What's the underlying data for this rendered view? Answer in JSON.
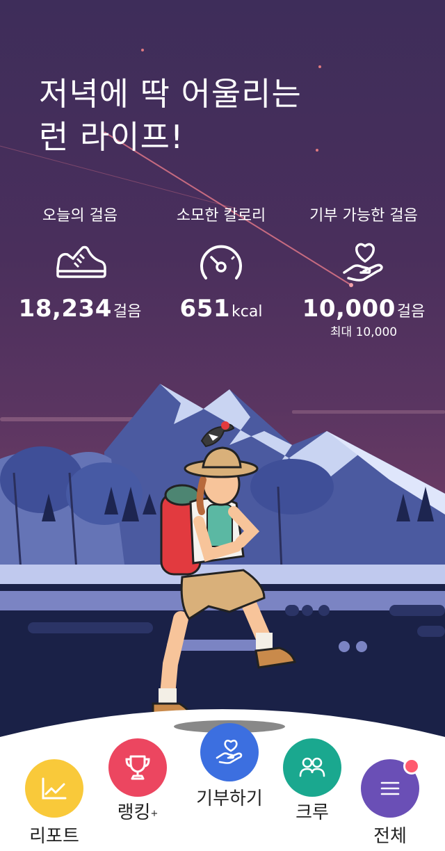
{
  "headline": {
    "line1": "저녁에 딱 어울리는",
    "line2": "런 라이프!"
  },
  "stats": {
    "steps": {
      "label": "오늘의 걸음",
      "icon": "sneaker-icon",
      "value": "18,234",
      "unit": "걸음"
    },
    "calories": {
      "label": "소모한 칼로리",
      "icon": "gauge-icon",
      "value": "651",
      "unit": "kcal"
    },
    "donation": {
      "label": "기부 가능한 걸음",
      "icon": "heart-hand-icon",
      "value": "10,000",
      "unit": "걸음",
      "max_label": "최대 10,000"
    }
  },
  "nav": {
    "report": {
      "label": "리포트",
      "icon": "chart-line-icon",
      "color": "#f9c93a"
    },
    "ranking": {
      "label": "랭킹",
      "superscript": "+",
      "icon": "trophy-icon",
      "color": "#ec4660"
    },
    "donate": {
      "label": "기부하기",
      "icon": "heart-hand-icon",
      "color": "#3c6fe0"
    },
    "crew": {
      "label": "크루",
      "icon": "people-icon",
      "color": "#1aa88f"
    },
    "all": {
      "label": "전체",
      "icon": "menu-icon",
      "color": "#6a4fb6",
      "has_notification": true
    }
  }
}
